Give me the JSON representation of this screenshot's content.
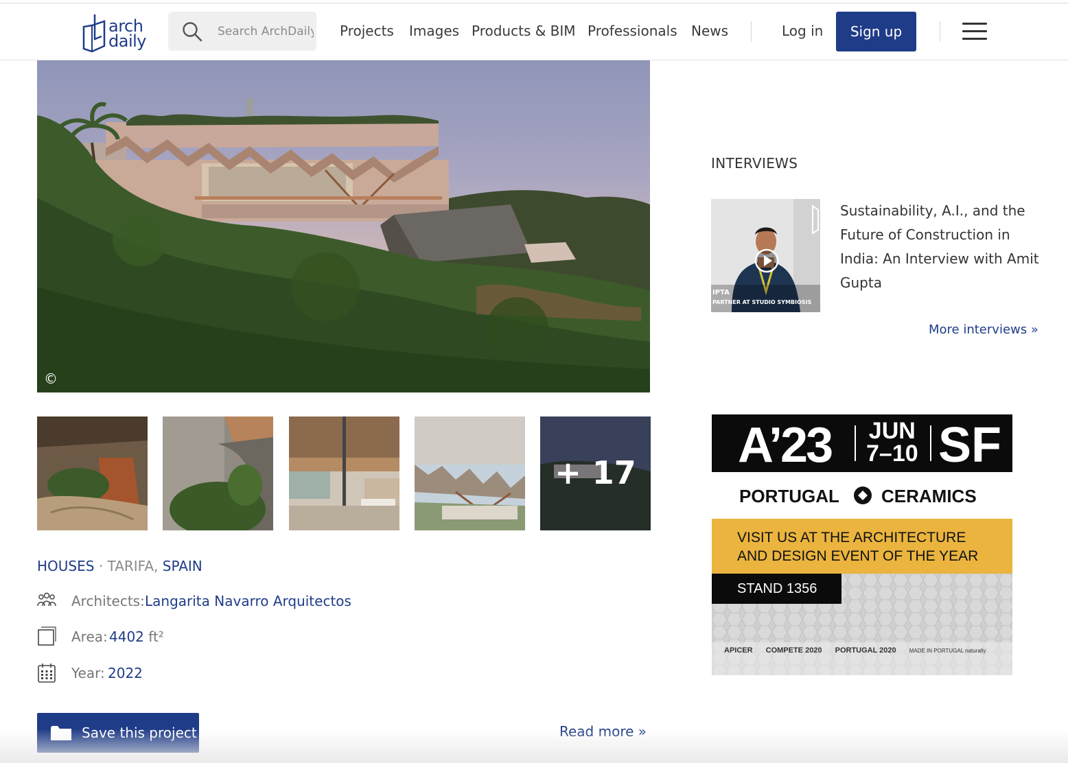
{
  "header": {
    "logo": {
      "line1": "arch",
      "line2": "daily"
    },
    "search_placeholder": "Search ArchDaily",
    "nav": [
      "Projects",
      "Images",
      "Products & BIM",
      "Professionals",
      "News"
    ],
    "login": "Log in",
    "signup": "Sign up"
  },
  "hero": {
    "copyright_symbol": "©"
  },
  "gallery": {
    "more_count": "+ 17"
  },
  "project": {
    "category": "HOUSES",
    "separator": "·",
    "city": "TARIFA,",
    "country": "SPAIN",
    "architects_label": "Architects:",
    "architects_value": "Langarita Navarro Arquitectos",
    "area_label": "Area:",
    "area_value": "4402",
    "area_unit": "ft²",
    "year_label": "Year:",
    "year_value": "2022",
    "save_label": "Save this project",
    "read_more": "Read more »"
  },
  "sidebar": {
    "section_title": "INTERVIEWS",
    "interview": {
      "title": "Sustainability, A.I., and the Future of Construction in India: An Interview with Amit Gupta",
      "caption_name": "IPTA",
      "caption_role": "PARTNER AT STUDIO SYMBIOSIS"
    },
    "more_interviews": "More interviews »"
  },
  "ad": {
    "big_left": "A’23",
    "month": "JUN",
    "days": "7–10",
    "big_right": "SF",
    "brand_left": "PORTUGAL",
    "brand_right": "CERAMICS",
    "visit_line1": "VISIT US AT THE ARCHITECTURE",
    "visit_line2": "AND DESIGN EVENT OF THE YEAR",
    "stand": "STAND 1356",
    "logos": [
      "APICER",
      "COMPETE 2020",
      "PORTUGAL 2020",
      "MADE IN PORTUGAL naturally"
    ]
  },
  "colors": {
    "brand_blue": "#1f3c88",
    "ad_yellow": "#eab43e"
  }
}
